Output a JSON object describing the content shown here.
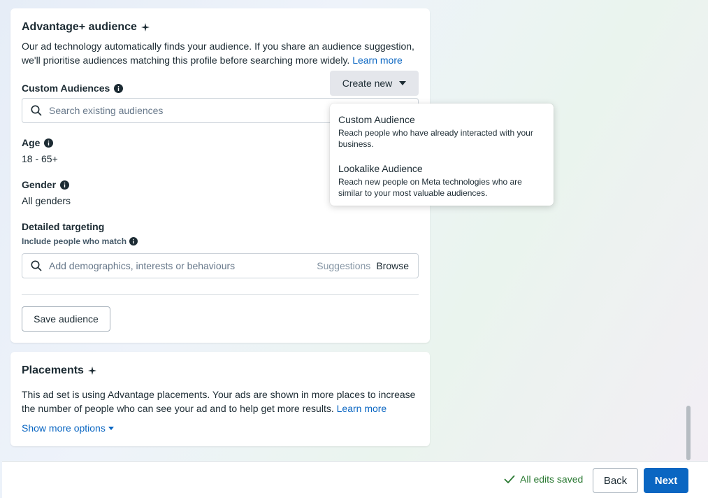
{
  "audience": {
    "title": "Advantage+ audience",
    "description": "Our ad technology automatically finds your audience. If you share an audience suggestion, we'll prioritise audiences matching this profile before searching more widely.",
    "learn_more": "Learn more",
    "custom_audiences_label": "Custom Audiences",
    "create_new_label": "Create new",
    "search_placeholder": "Search existing audiences",
    "age_label": "Age",
    "age_value": "18 - 65+",
    "gender_label": "Gender",
    "gender_value": "All genders",
    "detailed_label": "Detailed targeting",
    "include_label": "Include people who match",
    "detailed_placeholder": "Add demographics, interests or behaviours",
    "suggestions": "Suggestions",
    "browse": "Browse",
    "save_audience": "Save audience"
  },
  "dropdown": {
    "items": [
      {
        "title": "Custom Audience",
        "desc": "Reach people who have already interacted with your business."
      },
      {
        "title": "Lookalike Audience",
        "desc": "Reach new people on Meta technologies who are similar to your most valuable audiences."
      }
    ]
  },
  "placements": {
    "title": "Placements",
    "description": "This ad set is using Advantage placements. Your ads are shown in more places to increase the number of people who can see your ad and to help get more results.",
    "learn_more": "Learn more",
    "show_more": "Show more options"
  },
  "footer": {
    "status": "All edits saved",
    "back": "Back",
    "next": "Next"
  },
  "colors": {
    "primary": "#0a66c2",
    "success": "#2b7a33",
    "text": "#1c2b33"
  },
  "icons": [
    "sparkle-icon",
    "info-icon",
    "search-icon",
    "chevron-down-icon",
    "checkmark-icon"
  ]
}
